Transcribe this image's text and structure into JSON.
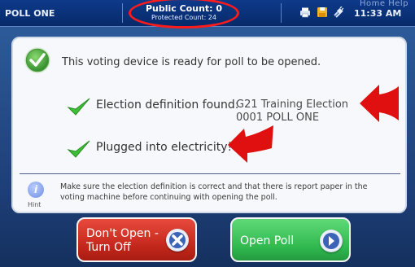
{
  "topbar": {
    "tabs_hint": "Home   Help",
    "poll_name": "POLL ONE",
    "public_count": "Public Count: 0",
    "protected_count": "Protected Count: 24",
    "clock": "11:33 AM"
  },
  "status": {
    "ready": "This voting device is ready for poll to be opened.",
    "election_label": "Election definition found:",
    "election_line1": "G21 Training Election",
    "election_line2": "0001 POLL ONE",
    "power_label": "Plugged into electricity!"
  },
  "hint": {
    "label": "Hint",
    "text": "Make sure the election definition is correct and that there is report paper in the voting machine before continuing with opening the poll."
  },
  "buttons": {
    "dont_open_line1": "Don't Open -",
    "dont_open_line2": "Turn Off",
    "open_poll": "Open Poll"
  },
  "colors": {
    "annotation": "#ff1b1b",
    "check": "#3cbf36",
    "dont_open": "#d0321f",
    "open_poll": "#3dc65b"
  }
}
